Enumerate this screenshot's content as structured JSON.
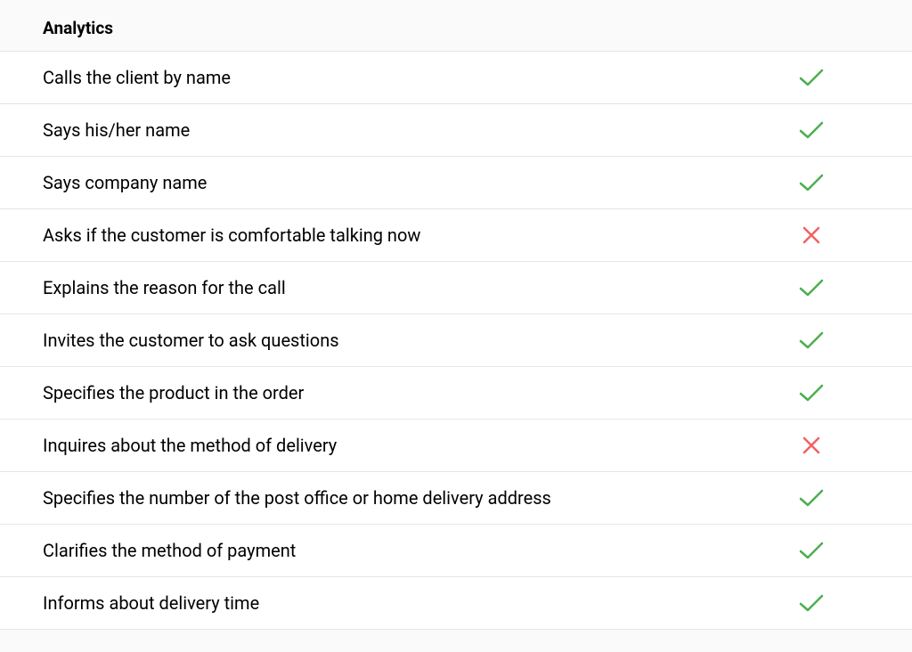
{
  "header": "Analytics",
  "items": [
    {
      "label": "Calls the client by name",
      "status": "check"
    },
    {
      "label": "Says his/her name",
      "status": "check"
    },
    {
      "label": "Says company name",
      "status": "check"
    },
    {
      "label": "Asks if the customer is comfortable talking now",
      "status": "cross"
    },
    {
      "label": "Explains the reason for the call",
      "status": "check"
    },
    {
      "label": "Invites the customer to ask questions",
      "status": "check"
    },
    {
      "label": "Specifies the product in the order",
      "status": "check"
    },
    {
      "label": "Inquires about the method of delivery",
      "status": "cross"
    },
    {
      "label": "Specifies the number of the post office or home delivery address",
      "status": "check"
    },
    {
      "label": "Clarifies the method of payment",
      "status": "check"
    },
    {
      "label": "Informs about delivery time",
      "status": "check"
    }
  ]
}
